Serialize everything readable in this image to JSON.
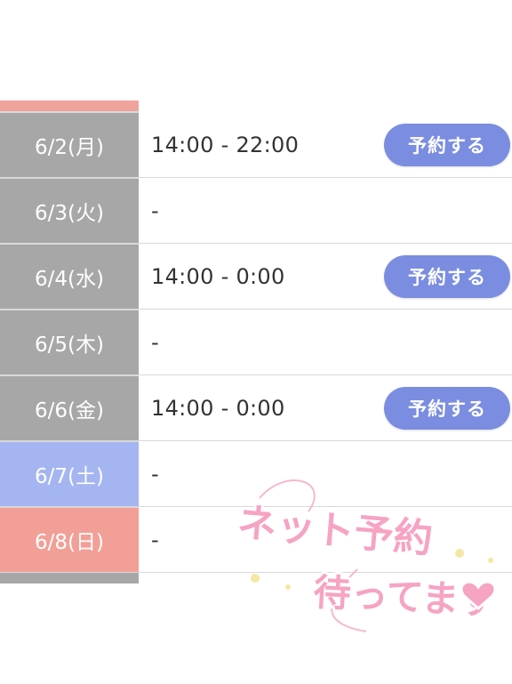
{
  "schedule": {
    "rows": [
      {
        "date": "6/2(月)",
        "time": "14:00 - 22:00",
        "button": "予約する",
        "kind": "weekday"
      },
      {
        "date": "6/3(火)",
        "time": "-",
        "button": null,
        "kind": "weekday"
      },
      {
        "date": "6/4(水)",
        "time": "14:00 - 0:00",
        "button": "予約する",
        "kind": "weekday"
      },
      {
        "date": "6/5(木)",
        "time": "-",
        "button": null,
        "kind": "weekday"
      },
      {
        "date": "6/6(金)",
        "time": "14:00 - 0:00",
        "button": "予約する",
        "kind": "weekday"
      },
      {
        "date": "6/7(土)",
        "time": "-",
        "button": null,
        "kind": "sat"
      },
      {
        "date": "6/8(日)",
        "time": "-",
        "button": null,
        "kind": "sun"
      }
    ]
  },
  "sticker": {
    "line1": "ネット予約",
    "line2": "待ってます"
  },
  "colors": {
    "weekday": "#a7a7a7",
    "saturday": "#a4b5f1",
    "sunday": "#f2a097",
    "button": "#7b8de0",
    "sticker_pink": "#f6a3c4"
  }
}
